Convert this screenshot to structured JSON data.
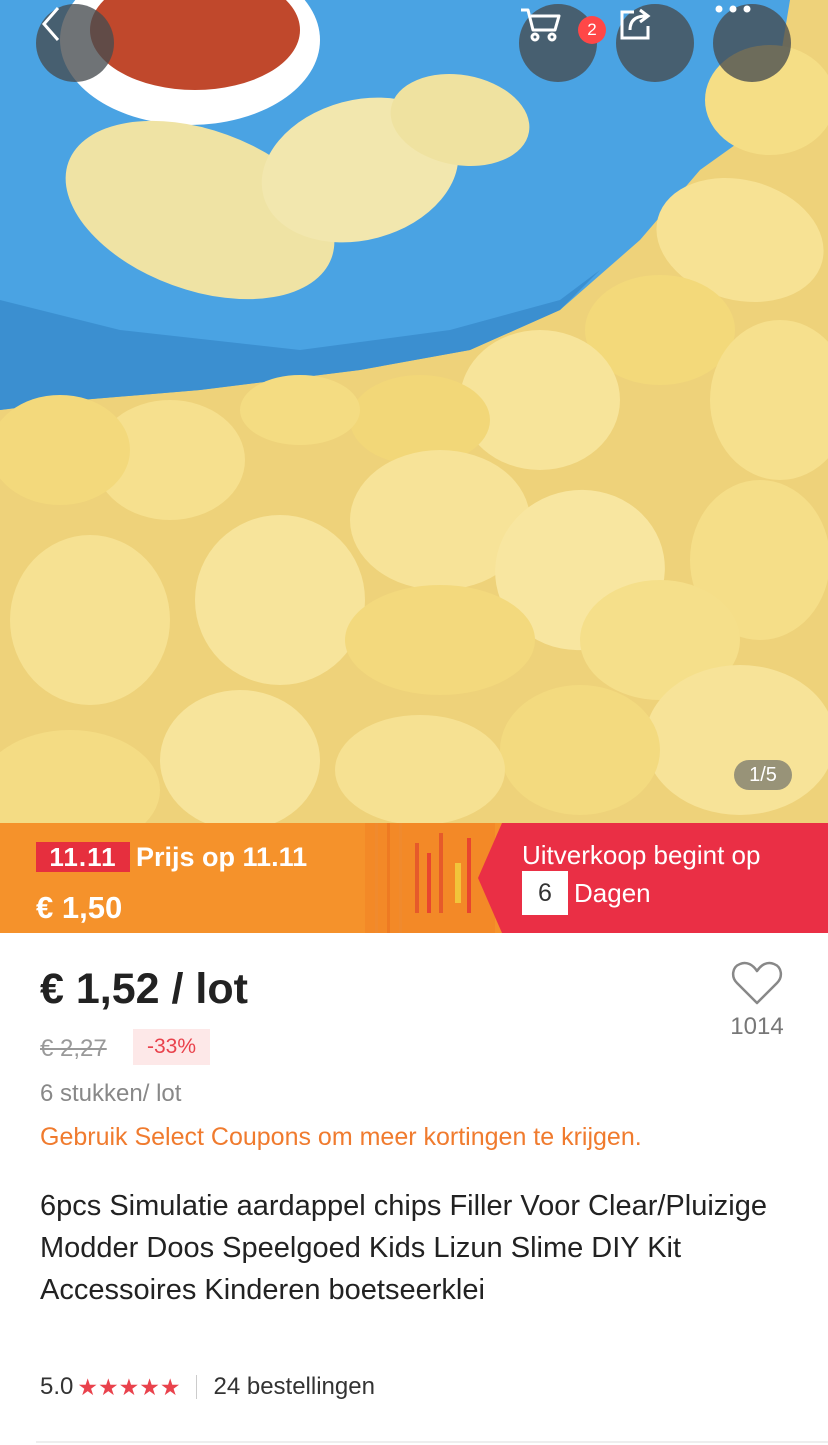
{
  "header": {
    "cart_count": "2",
    "image_counter": "1/5"
  },
  "promo": {
    "tag": "11.11",
    "label": "Prijs op 11.11",
    "price": "€ 1,50",
    "sale_text": "Uitverkoop begint op",
    "days_value": "6",
    "days_label": "Dagen"
  },
  "product": {
    "price": "€ 1,52 / lot",
    "wishlist_count": "1014",
    "old_price": "€ 2,27",
    "discount": "-33%",
    "lot_info": "6 stukken/ lot",
    "coupon_text": "Gebruik Select Coupons om meer kortingen te krijgen.",
    "title": "6pcs Simulatie aardappel chips Filler Voor Clear/Pluizige Modder Doos Speelgoed Kids Lizun Slime DIY Kit Accessoires Kinderen boetseerklei",
    "rating": "5.0",
    "stars": "★★★★★",
    "orders": "24 bestellingen"
  },
  "icons": {
    "back": "chevron-left-icon",
    "cart": "cart-icon",
    "share": "share-icon",
    "more": "more-dots-icon",
    "wishlist": "heart-icon"
  },
  "colors": {
    "promo_orange": "#f5922b",
    "promo_red": "#ea2f45",
    "accent_red": "#e9424c",
    "coupon_orange": "#f07b2e"
  }
}
